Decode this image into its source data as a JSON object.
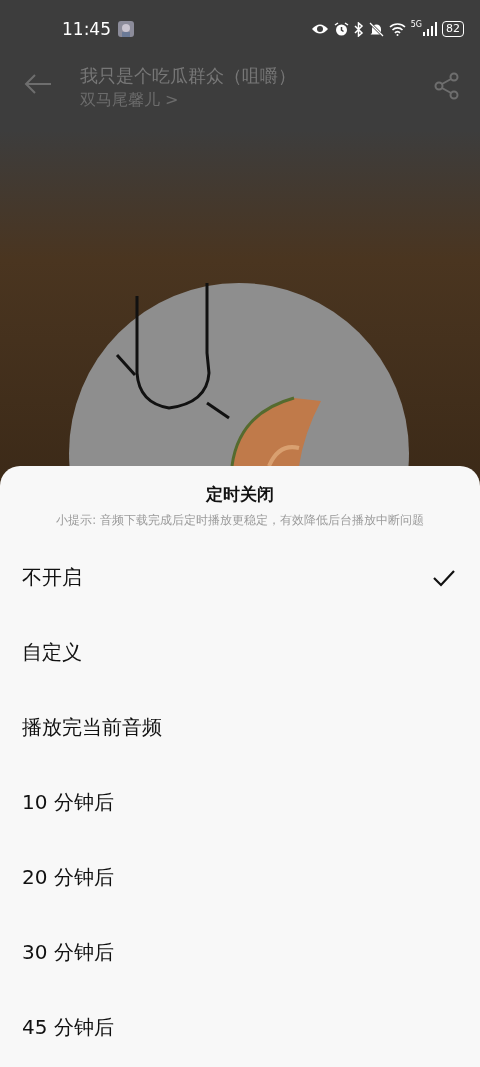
{
  "status_bar": {
    "time": "11:45",
    "network": "5G",
    "battery": "82"
  },
  "header": {
    "title": "我只是个吃瓜群众（咀嚼）",
    "artist": "双马尾馨儿 >"
  },
  "sheet": {
    "title": "定时关闭",
    "hint": "小提示: 音频下载完成后定时播放更稳定，有效降低后台播放中断问题",
    "options": [
      {
        "label": "不开启",
        "selected": true
      },
      {
        "label": "自定义",
        "selected": false
      },
      {
        "label": "播放完当前音频",
        "selected": false
      },
      {
        "label": "10 分钟后",
        "selected": false
      },
      {
        "label": "20 分钟后",
        "selected": false
      },
      {
        "label": "30 分钟后",
        "selected": false
      },
      {
        "label": "45 分钟后",
        "selected": false
      }
    ]
  }
}
